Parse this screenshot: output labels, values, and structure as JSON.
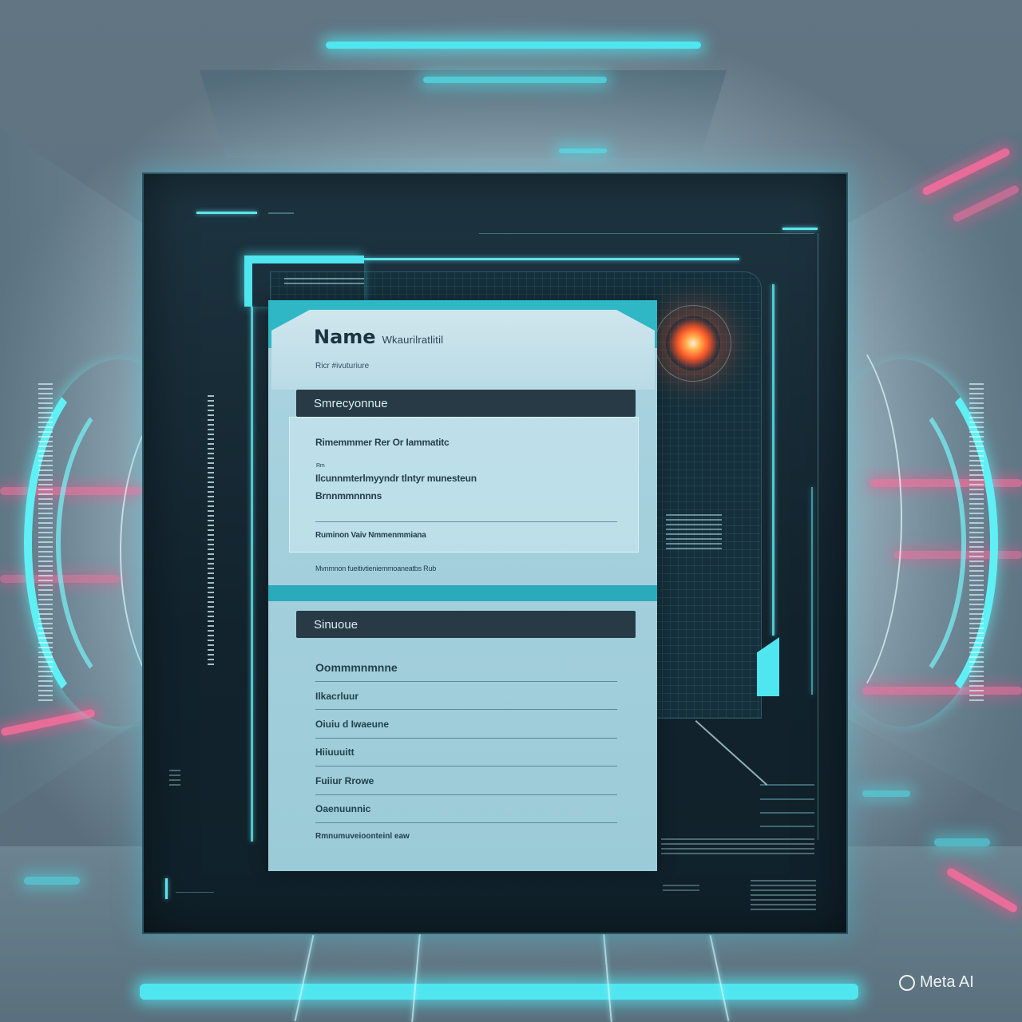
{
  "form": {
    "title": "Name",
    "title_suffix": "Wkaurilratlitil",
    "subtitle": "Ricr #ivuturiure",
    "section1": {
      "header": "Smrecyonnue",
      "field1": "Rimemmmer Rer Or Iammatitc",
      "field2_label": "Rm",
      "field2": "Ilcunnmterlmyyndr tlntyr munesteun",
      "field3": "Brnnmmnnnns",
      "field4": "Ruminon Vaiv Nmmenmmiana",
      "footnote": "Mvnmnon fueitivtieniemmoaneatbs Rub"
    },
    "section2": {
      "header": "Sinuoue",
      "items": [
        "Oommmnmnne",
        "Ilkacrluur",
        "Oiuiu d Iwaeune",
        "Hiiuuuitt",
        "Fuiiur Rrowe",
        "Oaenuunnic",
        "Rmnumuveioonteinl eaw"
      ]
    }
  },
  "watermark": {
    "text": "Meta AI"
  },
  "colors": {
    "accent_cyan": "#4fe6f0",
    "accent_pink": "#ff6b9c",
    "panel_dark": "#12232d",
    "card_bg": "#a9d3df",
    "section_bar": "#273a45"
  }
}
